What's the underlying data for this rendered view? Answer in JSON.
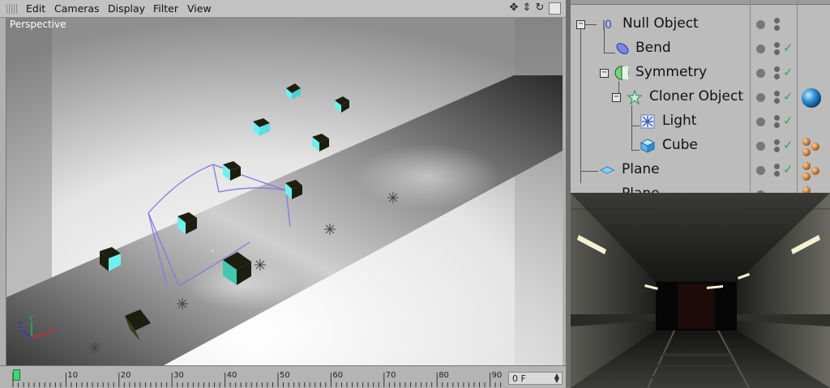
{
  "menu": {
    "items": [
      "Edit",
      "Cameras",
      "Display",
      "Filter",
      "View"
    ]
  },
  "viewport": {
    "label": "Perspective",
    "axis_labels": {
      "x": "X",
      "y": "Y",
      "z": "Z"
    }
  },
  "timeline": {
    "ticks": [
      "0",
      "10",
      "20",
      "30",
      "40",
      "50",
      "60",
      "70",
      "80",
      "90"
    ],
    "current_frame": "0 F"
  },
  "object_manager": {
    "objects": [
      {
        "name": "Null Object",
        "icon": "null-object-icon"
      },
      {
        "name": "Bend",
        "icon": "bend-deformer-icon"
      },
      {
        "name": "Symmetry",
        "icon": "symmetry-icon"
      },
      {
        "name": "Cloner Object",
        "icon": "cloner-icon"
      },
      {
        "name": "Light",
        "icon": "light-icon"
      },
      {
        "name": "Cube",
        "icon": "cube-icon"
      },
      {
        "name": "Plane",
        "icon": "plane-icon"
      },
      {
        "name": "Plane",
        "icon": "plane-icon"
      }
    ]
  },
  "colors": {
    "check": "#2faa44",
    "playhead": "#43d66f",
    "cube_face": "#6ff0f0",
    "deformer_cage": "#8877dd"
  }
}
